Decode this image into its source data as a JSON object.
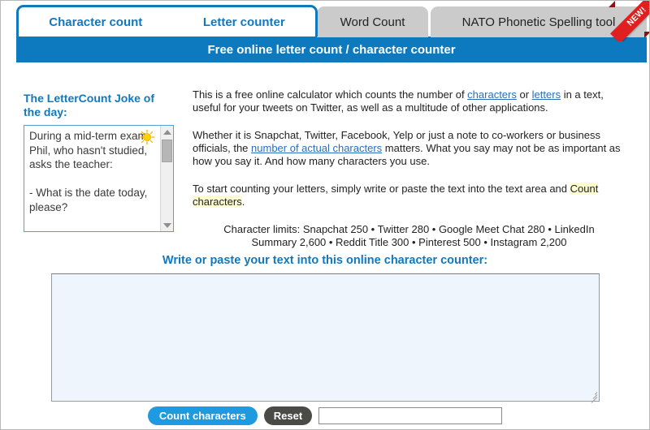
{
  "tabs": {
    "active": {
      "links": [
        {
          "label": "Character count"
        },
        {
          "label": "Letter counter"
        }
      ]
    },
    "inactive": [
      {
        "label": "Word Count"
      },
      {
        "label": "NATO Phonetic Spelling tool"
      }
    ],
    "ribbon_label": "NEW!"
  },
  "header": {
    "title": "Free online letter count / character counter"
  },
  "joke": {
    "title": "The LetterCount\nJoke of the day:",
    "icon": "sun-icon",
    "text": "During a mid-term exam, Phil, who hasn't studied, asks the teacher:\n\n- What is the date today, please?\n\nThe teacher answers him:"
  },
  "intro": {
    "p1_a": "This is a free online calculator which counts the number of ",
    "p1_link1": "characters",
    "p1_b": " or ",
    "p1_link2": "letters",
    "p1_c": " in a text, useful for your tweets on Twitter, as well as a multitude of other applications.",
    "p2_a": "Whether it is Snapchat, Twitter, Facebook, Yelp or just a note to co-workers or business officials, the ",
    "p2_link": "number of actual characters",
    "p2_b": " matters. What you say may not be as important as how you say it. And how many characters you use.",
    "p3_a": "To start counting your letters, simply write or paste the text into the text area and ",
    "p3_highlight1": "Count",
    "p3_b": " ",
    "p3_highlight2": "characters",
    "p3_c": "."
  },
  "limits": {
    "line1": "Character limits: Snapchat 250 • Twitter 280 • Google Meet Chat 280 • LinkedIn",
    "line2": "Summary 2,600 • Reddit Title 300 • Pinterest 500 • Instagram 2,200"
  },
  "textarea": {
    "heading": "Write or paste your text into this online character counter:",
    "value": "",
    "placeholder": ""
  },
  "buttons": {
    "count_label": "Count characters",
    "reset_label": "Reset",
    "result_value": "",
    "result_placeholder": ""
  },
  "colors": {
    "brand_blue": "#0d7abf",
    "tab_border": "#1178be",
    "link_blue": "#2a6ebb",
    "limits_blue": "#2f86d4",
    "tab_gray": "#cbcbcb",
    "ribbon_red": "#e02020",
    "button_blue": "#1e9ae0",
    "button_gray": "#4a4a47",
    "textarea_bg": "#eff5fd",
    "highlight_yellow": "#fdfdd2"
  }
}
